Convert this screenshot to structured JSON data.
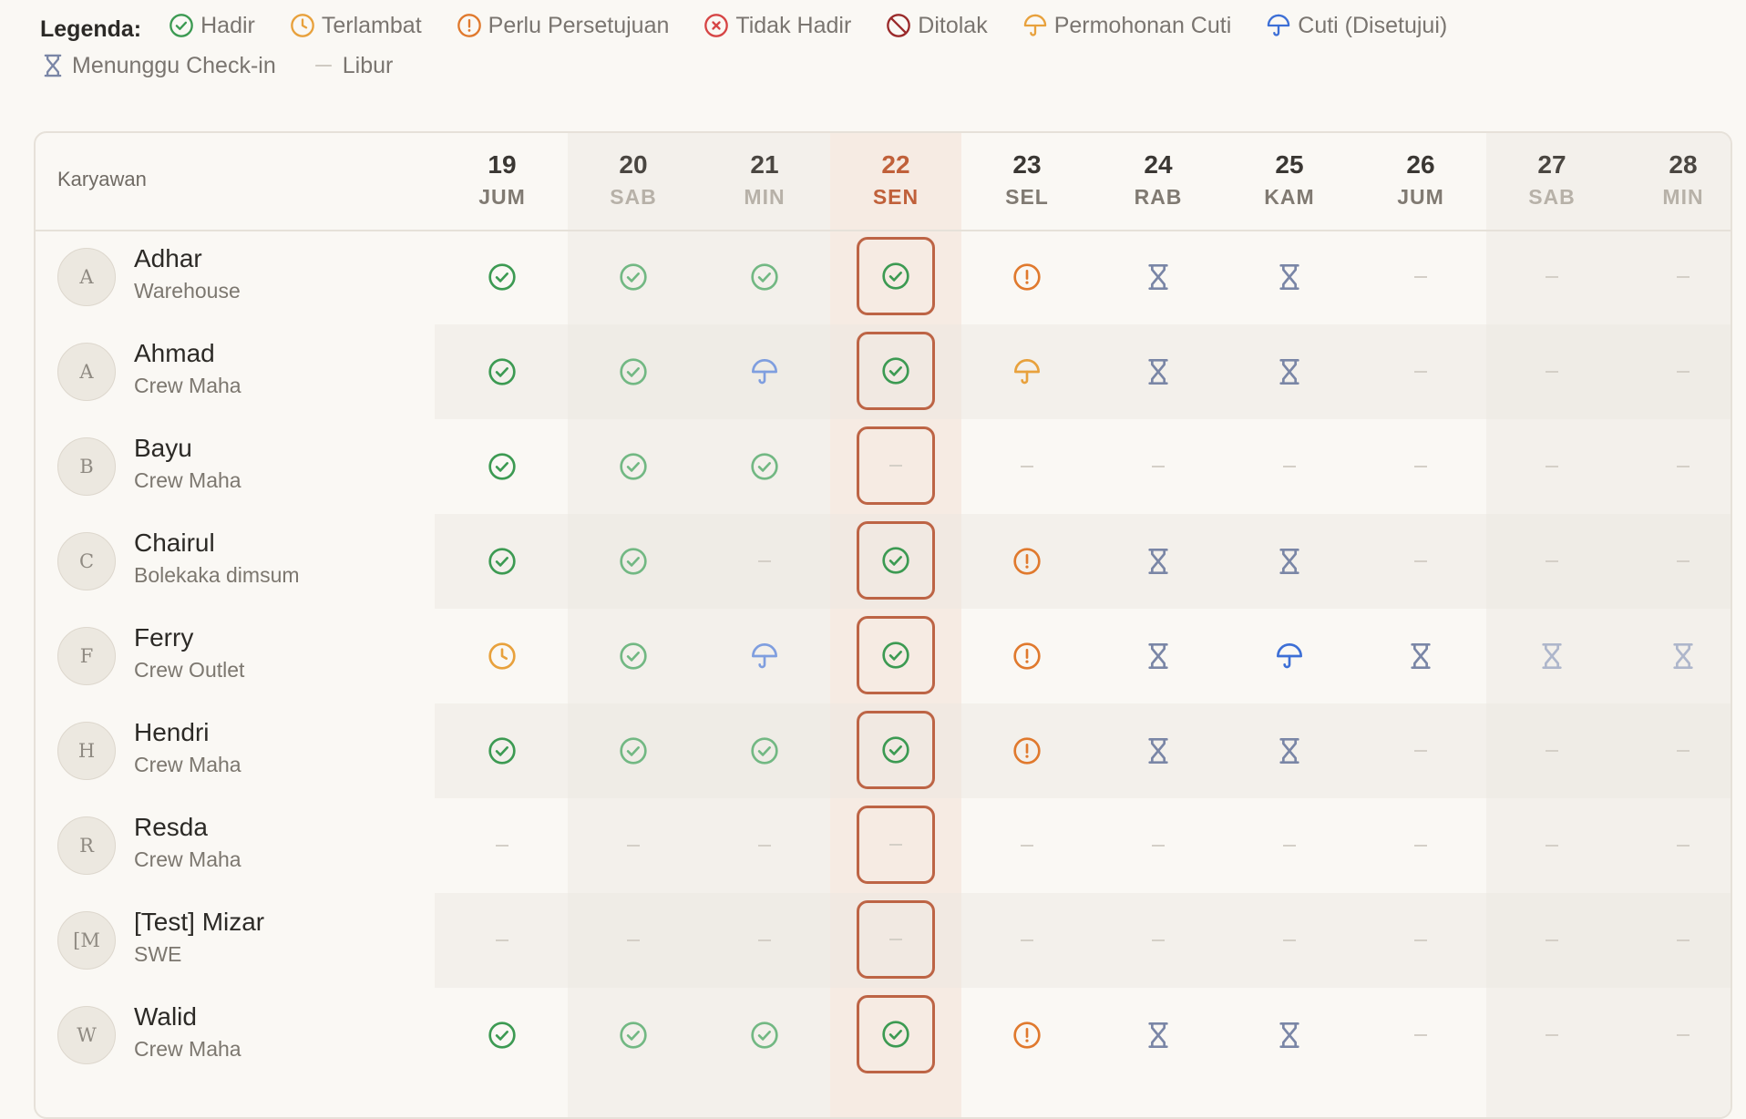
{
  "legend": {
    "title": "Legenda:",
    "items": [
      {
        "icon": "check",
        "label": "Hadir",
        "color": "#3c9a52"
      },
      {
        "icon": "clock",
        "label": "Terlambat",
        "color": "#e8a13c"
      },
      {
        "icon": "alert",
        "label": "Perlu Persetujuan",
        "color": "#e0792d"
      },
      {
        "icon": "x",
        "label": "Tidak Hadir",
        "color": "#d64545"
      },
      {
        "icon": "ban",
        "label": "Ditolak",
        "color": "#9a2a2a"
      },
      {
        "icon": "umbrella",
        "label": "Permohonan Cuti",
        "color": "#e8a13c"
      },
      {
        "icon": "umbrella",
        "label": "Cuti (Disetujui)",
        "color": "#3d6fd6"
      },
      {
        "icon": "hourglass",
        "label": "Menunggu Check-in",
        "color": "#7a86a6"
      },
      {
        "icon": "dash",
        "label": "Libur",
        "color": "#c9c4bb"
      }
    ]
  },
  "table": {
    "employee_header": "Karyawan",
    "days": [
      {
        "num": "19",
        "name": "JUM",
        "type": "normal"
      },
      {
        "num": "20",
        "name": "SAB",
        "type": "weekend"
      },
      {
        "num": "21",
        "name": "MIN",
        "type": "weekend"
      },
      {
        "num": "22",
        "name": "SEN",
        "type": "today"
      },
      {
        "num": "23",
        "name": "SEL",
        "type": "normal"
      },
      {
        "num": "24",
        "name": "RAB",
        "type": "normal"
      },
      {
        "num": "25",
        "name": "KAM",
        "type": "normal"
      },
      {
        "num": "26",
        "name": "JUM",
        "type": "normal"
      },
      {
        "num": "27",
        "name": "SAB",
        "type": "weekend"
      },
      {
        "num": "28",
        "name": "MIN",
        "type": "weekend"
      }
    ],
    "employees": [
      {
        "initial": "A",
        "name": "Adhar",
        "dept": "Warehouse",
        "status": [
          "check",
          "check-light",
          "check-light",
          "check",
          "alert",
          "hourglass",
          "hourglass",
          "dash",
          "dash",
          "dash"
        ]
      },
      {
        "initial": "A",
        "name": "Ahmad",
        "dept": "Crew Maha",
        "status": [
          "check",
          "check-light",
          "umbrella-light",
          "check",
          "umbrella-pending",
          "hourglass",
          "hourglass",
          "dash",
          "dash",
          "dash"
        ]
      },
      {
        "initial": "B",
        "name": "Bayu",
        "dept": "Crew Maha",
        "status": [
          "check",
          "check-light",
          "check-light",
          "dash",
          "dash",
          "dash",
          "dash",
          "dash",
          "dash",
          "dash"
        ]
      },
      {
        "initial": "C",
        "name": "Chairul",
        "dept": "Bolekaka dimsum",
        "status": [
          "check",
          "check-light",
          "dash",
          "check",
          "alert",
          "hourglass",
          "hourglass",
          "dash",
          "dash",
          "dash"
        ]
      },
      {
        "initial": "F",
        "name": "Ferry",
        "dept": "Crew Outlet",
        "status": [
          "clock",
          "check-light",
          "umbrella-light",
          "check",
          "alert",
          "hourglass",
          "umbrella",
          "hourglass",
          "hourglass-light",
          "hourglass-light"
        ]
      },
      {
        "initial": "H",
        "name": "Hendri",
        "dept": "Crew Maha",
        "status": [
          "check",
          "check-light",
          "check-light",
          "check",
          "alert",
          "hourglass",
          "hourglass",
          "dash",
          "dash",
          "dash"
        ]
      },
      {
        "initial": "R",
        "name": "Resda",
        "dept": "Crew Maha",
        "status": [
          "dash",
          "dash",
          "dash",
          "dash",
          "dash",
          "dash",
          "dash",
          "dash",
          "dash",
          "dash"
        ]
      },
      {
        "initial": "[M",
        "name": "[Test] Mizar",
        "dept": "SWE",
        "status": [
          "dash",
          "dash",
          "dash",
          "dash",
          "dash",
          "dash",
          "dash",
          "dash",
          "dash",
          "dash"
        ]
      },
      {
        "initial": "W",
        "name": "Walid",
        "dept": "Crew Maha",
        "status": [
          "check",
          "check-light",
          "check-light",
          "check",
          "alert",
          "hourglass",
          "hourglass",
          "dash",
          "dash",
          "dash"
        ]
      }
    ]
  }
}
